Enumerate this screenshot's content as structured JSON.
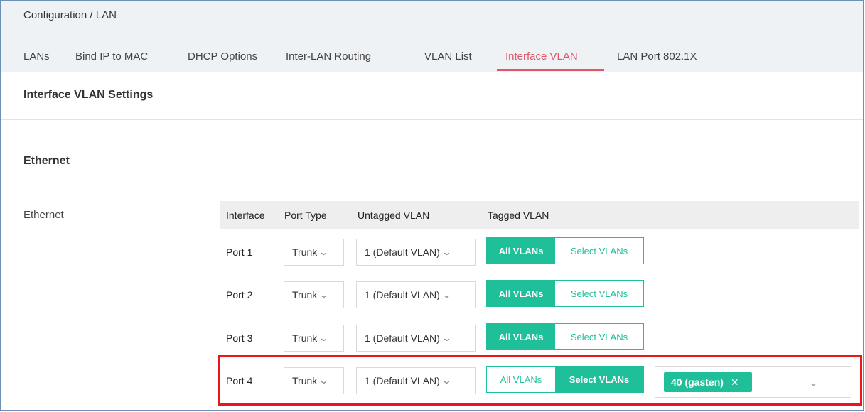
{
  "breadcrumb": "Configuration / LAN",
  "tabs": [
    {
      "label": "LANs"
    },
    {
      "label": "Bind IP to MAC"
    },
    {
      "label": "DHCP Options"
    },
    {
      "label": "Inter-LAN Routing"
    },
    {
      "label": "VLAN List"
    },
    {
      "label": "Interface VLAN",
      "active": true
    },
    {
      "label": "LAN Port 802.1X"
    }
  ],
  "section_title": "Interface VLAN Settings",
  "ethernet_heading": "Ethernet",
  "ethernet_label": "Ethernet",
  "table": {
    "headers": [
      "Interface",
      "Port Type",
      "Untagged VLAN",
      "Tagged VLAN"
    ],
    "rows": [
      {
        "interface": "Port 1",
        "port_type": "Trunk",
        "untagged": "1 (Default VLAN)",
        "all_vlans": "All VLANs",
        "select_vlans": "Select VLANs",
        "mode": "all"
      },
      {
        "interface": "Port 2",
        "port_type": "Trunk",
        "untagged": "1 (Default VLAN)",
        "all_vlans": "All VLANs",
        "select_vlans": "Select VLANs",
        "mode": "all"
      },
      {
        "interface": "Port 3",
        "port_type": "Trunk",
        "untagged": "1 (Default VLAN)",
        "all_vlans": "All VLANs",
        "select_vlans": "Select VLANs",
        "mode": "all"
      },
      {
        "interface": "Port 4",
        "port_type": "Trunk",
        "untagged": "1 (Default VLAN)",
        "all_vlans": "All VLANs",
        "select_vlans": "Select VLANs",
        "mode": "select",
        "selected_tags": [
          "40 (gasten)"
        ]
      }
    ]
  },
  "colors": {
    "accent": "#1fbf99",
    "active_tab": "#e05667",
    "highlight": "#e8171b"
  }
}
